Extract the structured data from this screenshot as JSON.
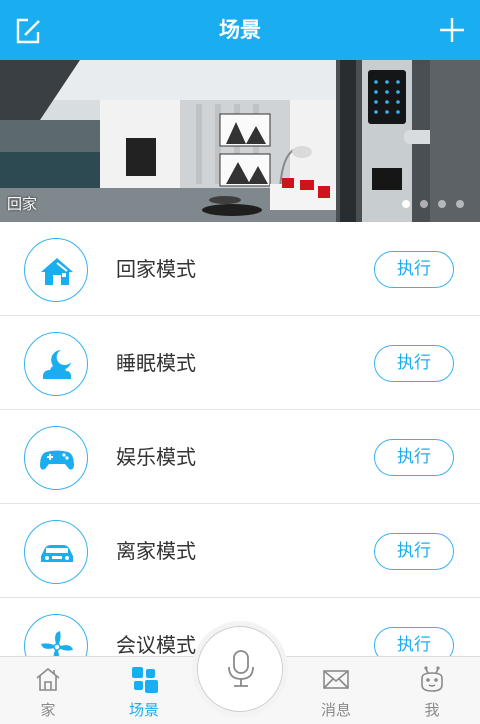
{
  "header": {
    "title": "场景"
  },
  "banner": {
    "caption": "回家"
  },
  "scenes": [
    {
      "label": "回家模式",
      "action": "执行"
    },
    {
      "label": "睡眠模式",
      "action": "执行"
    },
    {
      "label": "娱乐模式",
      "action": "执行"
    },
    {
      "label": "离家模式",
      "action": "执行"
    },
    {
      "label": "会议模式",
      "action": "执行"
    }
  ],
  "tabs": [
    {
      "label": "家"
    },
    {
      "label": "场景"
    },
    {
      "label": "消息"
    },
    {
      "label": "我"
    }
  ],
  "colors": {
    "accent": "#1aaef0",
    "text": "#333333",
    "tab_inactive": "#8a8a8a"
  }
}
